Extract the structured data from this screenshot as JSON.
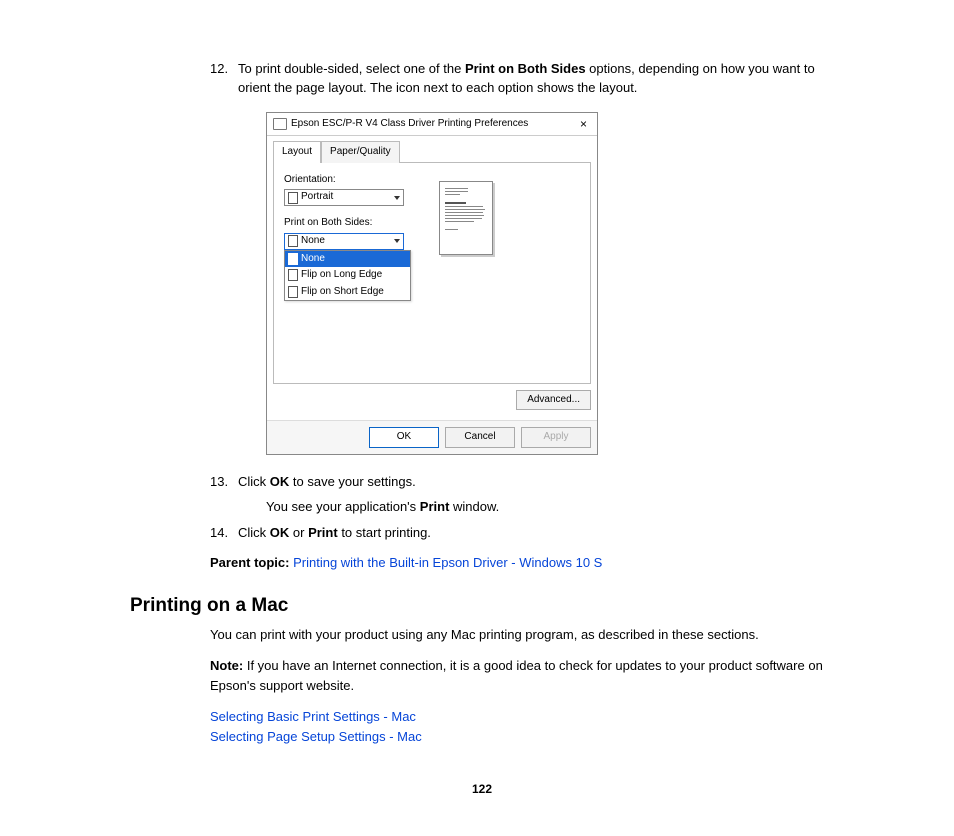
{
  "steps": {
    "s12": {
      "num": "12.",
      "text_a": "To print double-sided, select one of the ",
      "bold_a": "Print on Both Sides",
      "text_b": " options, depending on how you want to orient the page layout. The icon next to each option shows the layout."
    },
    "s13": {
      "num": "13.",
      "text_a": "Click ",
      "bold_a": "OK",
      "text_b": " to save your settings.",
      "sub_a": "You see your application's ",
      "sub_bold": "Print",
      "sub_b": " window."
    },
    "s14": {
      "num": "14.",
      "text_a": "Click ",
      "bold_a": "OK",
      "text_b": " or ",
      "bold_b": "Print",
      "text_c": " to start printing."
    }
  },
  "dialog": {
    "title": "Epson ESC/P-R V4 Class Driver Printing Preferences",
    "close": "×",
    "tabs": {
      "layout": "Layout",
      "paper": "Paper/Quality"
    },
    "orientation_label": "Orientation:",
    "orientation_value": "Portrait",
    "both_sides_label": "Print on Both Sides:",
    "both_sides_value": "None",
    "options": {
      "none": "None",
      "long": "Flip on Long Edge",
      "short": "Flip on Short Edge"
    },
    "advanced": "Advanced...",
    "ok": "OK",
    "cancel": "Cancel",
    "apply": "Apply"
  },
  "parent": {
    "label": "Parent topic:",
    "link": "Printing with the Built-in Epson Driver - Windows 10 S"
  },
  "section": {
    "heading": "Printing on a Mac",
    "intro": "You can print with your product using any Mac printing program, as described in these sections.",
    "note_label": "Note:",
    "note_text": " If you have an Internet connection, it is a good idea to check for updates to your product software on Epson's support website.",
    "link1": "Selecting Basic Print Settings - Mac",
    "link2": "Selecting Page Setup Settings - Mac"
  },
  "page_number": "122"
}
